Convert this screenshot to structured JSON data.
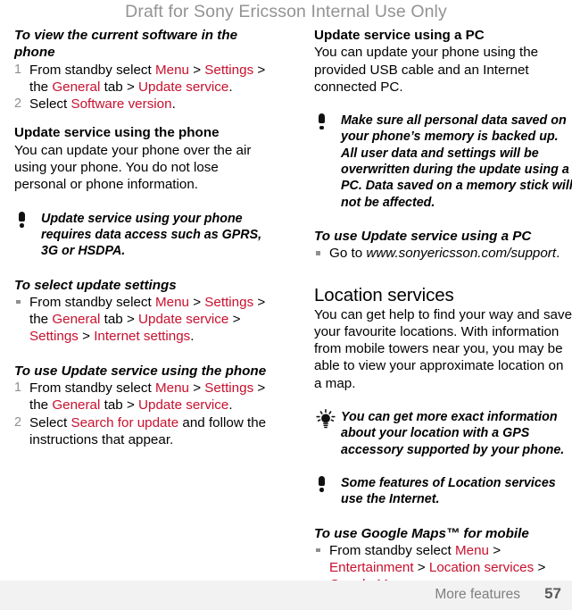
{
  "header": {
    "watermark": "Draft for Sony Ericsson Internal Use Only"
  },
  "colors": {
    "link_red": "#c8102e",
    "watermark_gray": "#939393",
    "marker_gray": "#8f8f8f",
    "footer_bg": "#f2f2f2"
  },
  "left_column": {
    "proc1": {
      "heading": "To view the current software in the phone",
      "steps": [
        {
          "num": "1",
          "parts": [
            {
              "t": "From standby select ",
              "red": false
            },
            {
              "t": "Menu",
              "red": true
            },
            {
              "t": " > ",
              "red": false
            },
            {
              "t": "Settings",
              "red": true
            },
            {
              "t": " > the ",
              "red": false
            },
            {
              "t": "General",
              "red": true
            },
            {
              "t": " tab > ",
              "red": false
            },
            {
              "t": "Update service",
              "red": true
            },
            {
              "t": ".",
              "red": false
            }
          ]
        },
        {
          "num": "2",
          "parts": [
            {
              "t": "Select ",
              "red": false
            },
            {
              "t": "Software version",
              "red": true
            },
            {
              "t": ".",
              "red": false
            }
          ]
        }
      ]
    },
    "section_phone": {
      "heading": "Update service using the phone",
      "body": "You can update your phone over the air using your phone. You do not lose personal or phone information."
    },
    "note_phone": {
      "icon": "note-exclamation-icon",
      "text": "Update service using your phone requires data access such as GPRS, 3G or HSDPA."
    },
    "proc2": {
      "heading": "To select update settings",
      "steps": [
        {
          "bullet": "•",
          "parts": [
            {
              "t": "From standby select ",
              "red": false
            },
            {
              "t": "Menu",
              "red": true
            },
            {
              "t": " > ",
              "red": false
            },
            {
              "t": "Settings",
              "red": true
            },
            {
              "t": " > the ",
              "red": false
            },
            {
              "t": "General",
              "red": true
            },
            {
              "t": " tab > ",
              "red": false
            },
            {
              "t": "Update service",
              "red": true
            },
            {
              "t": " > ",
              "red": false
            },
            {
              "t": "Settings",
              "red": true
            },
            {
              "t": " > ",
              "red": false
            },
            {
              "t": "Internet settings",
              "red": true
            },
            {
              "t": ".",
              "red": false
            }
          ]
        }
      ]
    },
    "proc3": {
      "heading": "To use Update service using the phone",
      "steps": [
        {
          "num": "1",
          "parts": [
            {
              "t": "From standby select ",
              "red": false
            },
            {
              "t": "Menu",
              "red": true
            },
            {
              "t": " > ",
              "red": false
            },
            {
              "t": "Settings",
              "red": true
            },
            {
              "t": " > the ",
              "red": false
            },
            {
              "t": "General",
              "red": true
            },
            {
              "t": " tab > ",
              "red": false
            },
            {
              "t": "Update service",
              "red": true
            },
            {
              "t": ".",
              "red": false
            }
          ]
        },
        {
          "num": "2",
          "parts": [
            {
              "t": "Select ",
              "red": false
            },
            {
              "t": "Search for update",
              "red": true
            },
            {
              "t": " and follow the instructions that appear.",
              "red": false
            }
          ]
        }
      ]
    }
  },
  "right_column": {
    "section_pc": {
      "heading": "Update service using a PC",
      "body": "You can update your phone using the provided USB cable and an Internet connected PC."
    },
    "note_pc": {
      "icon": "note-exclamation-icon",
      "text": "Make sure all personal data saved on your phone’s memory is backed up. All user data and settings will be overwritten during the update using a PC. Data saved on a memory stick will not be affected."
    },
    "proc_pc": {
      "heading": "To use Update service using a PC",
      "steps": [
        {
          "bullet": "•",
          "parts": [
            {
              "t": "Go to ",
              "red": false,
              "italic": false
            },
            {
              "t": "www.sonyericsson.com/support",
              "red": false,
              "italic": true
            },
            {
              "t": ".",
              "red": false,
              "italic": false
            }
          ]
        }
      ]
    },
    "section_location": {
      "heading": "Location services",
      "body": "You can get help to find your way and save your favourite locations. With information from mobile towers near you, you may be able to view your approximate location on a map."
    },
    "tip_location": {
      "icon": "tip-lightbulb-icon",
      "text": "You can get more exact information about your location with a GPS accessory supported by your phone."
    },
    "note_location": {
      "icon": "note-exclamation-icon",
      "text": "Some features of Location services use the Internet."
    },
    "proc_maps": {
      "heading": "To use Google Maps™ for mobile",
      "steps": [
        {
          "bullet": "•",
          "parts": [
            {
              "t": "From standby select ",
              "red": false
            },
            {
              "t": "Menu",
              "red": true
            },
            {
              "t": " > ",
              "red": false
            },
            {
              "t": "Entertainment",
              "red": true
            },
            {
              "t": " > ",
              "red": false
            },
            {
              "t": "Location services",
              "red": true
            },
            {
              "t": " > ",
              "red": false
            },
            {
              "t": "Google Maps",
              "red": true
            },
            {
              "t": ".",
              "red": false
            }
          ]
        }
      ]
    }
  },
  "footer": {
    "chapter": "More features",
    "page_number": "57"
  }
}
